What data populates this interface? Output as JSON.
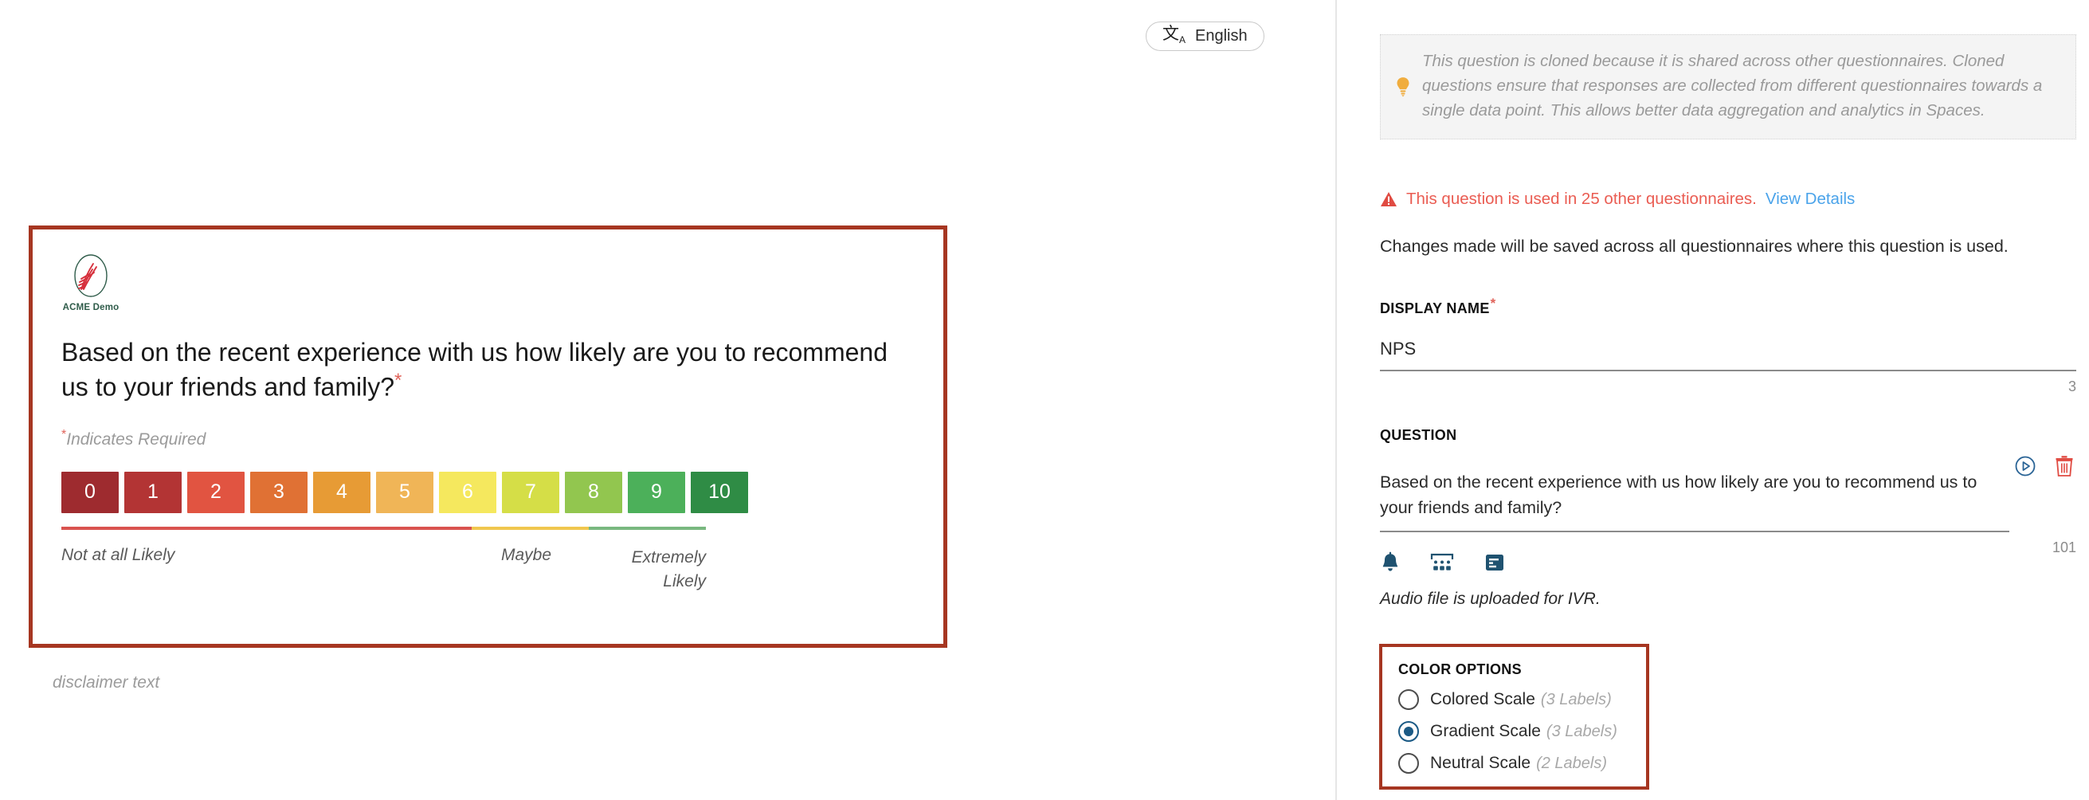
{
  "preview": {
    "language_button": {
      "label": "English",
      "icon": "translate-icon"
    },
    "brand": {
      "name": "ACME Demo"
    },
    "question_text": "Based on the recent experience with us how likely are you to recommend us to your friends and family?",
    "required_marker": "*",
    "required_note": "Indicates Required",
    "scale": {
      "values": [
        "0",
        "1",
        "2",
        "3",
        "4",
        "5",
        "6",
        "7",
        "8",
        "9",
        "10"
      ],
      "colors": [
        "#9e2b2f",
        "#b33434",
        "#e15441",
        "#e07134",
        "#e79b35",
        "#f0b557",
        "#f5e85e",
        "#d5de47",
        "#92c64f",
        "#4cb05a",
        "#2f8c45"
      ]
    },
    "segments": [
      {
        "color": "#d9534f",
        "flex": 7
      },
      {
        "color": "#f0c74e",
        "flex": 2
      },
      {
        "color": "#79b87f",
        "flex": 2
      }
    ],
    "anchors": {
      "left": "Not at all Likely",
      "middle": "Maybe",
      "right": "Extremely Likely"
    },
    "disclaimer": "disclaimer text"
  },
  "settings": {
    "info_callout": {
      "icon": "lightbulb-icon",
      "text": "This question is cloned because it is shared across other questionnaires. Cloned questions ensure that responses are collected from different questionnaires towards a single data point. This allows better data aggregation and analytics in Spaces."
    },
    "warning": {
      "icon": "warning-triangle-icon",
      "text": "This question is used in 25 other questionnaires.",
      "link": "View Details",
      "count": 25,
      "color": "#ea5c52",
      "link_color": "#4aa3ea"
    },
    "changes_note": "Changes made will be saved across all questionnaires where this question is used.",
    "display_name": {
      "label": "DISPLAY NAME",
      "required": "*",
      "value": "NPS",
      "char_count": "3"
    },
    "question": {
      "label": "QUESTION",
      "value": "Based on the recent experience with us how likely are you to recommend us to your friends and family?",
      "char_count": "101",
      "play_icon": "play-circle-icon",
      "delete_icon": "trash-icon"
    },
    "media_icons": [
      "bell-icon",
      "keypad-icon",
      "form-icon"
    ],
    "audio_note": "Audio file is uploaded for IVR.",
    "color_options": {
      "label": "COLOR OPTIONS",
      "highlight_color": "#a63621",
      "options": [
        {
          "label": "Colored Scale",
          "sub": "(3 Labels)",
          "selected": false
        },
        {
          "label": "Gradient Scale",
          "sub": "(3 Labels)",
          "selected": true
        },
        {
          "label": "Neutral Scale",
          "sub": "(2 Labels)",
          "selected": false
        }
      ]
    }
  }
}
